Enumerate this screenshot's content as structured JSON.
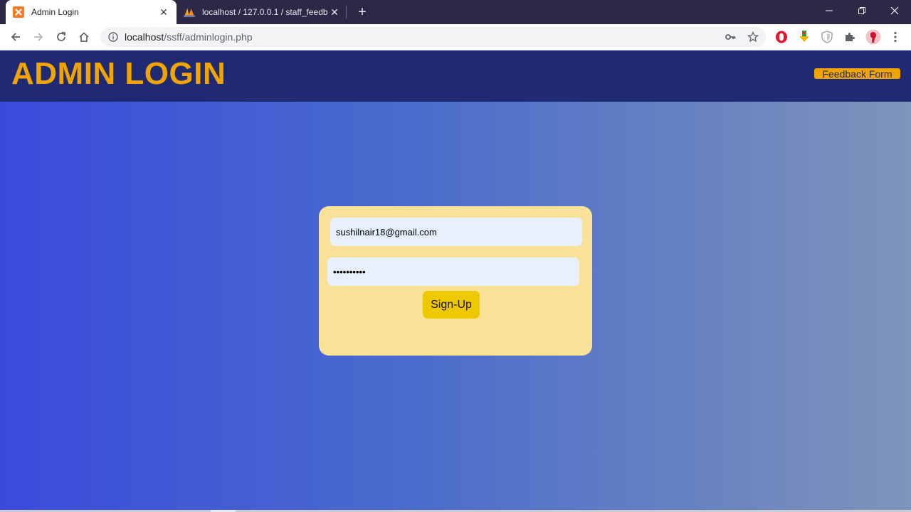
{
  "browser": {
    "tabs": [
      {
        "title": "Admin Login",
        "favicon": "xampp-icon",
        "active": true
      },
      {
        "title": "localhost / 127.0.0.1 / staff_feedb",
        "favicon": "phpmyadmin-icon",
        "active": false
      }
    ],
    "new_tab_label": "+",
    "address": {
      "host": "localhost",
      "path": "/ssff/adminlogin.php"
    },
    "toolbar_icons": [
      "back-icon",
      "forward-icon",
      "reload-icon",
      "home-icon",
      "info-icon",
      "key-icon",
      "star-icon",
      "opera-icon",
      "download-extension-icon",
      "shield-icon",
      "puzzle-icon",
      "profile-avatar-icon",
      "menu-icon"
    ],
    "window_controls": [
      "minimize-icon",
      "restore-icon",
      "close-icon"
    ]
  },
  "header": {
    "title": "ADMIN LOGIN",
    "feedback_button": "Feedback Form"
  },
  "login_form": {
    "email_value": "sushilnair18@gmail.com",
    "password_value": "••••••••••",
    "submit_label": "Sign-Up"
  },
  "colors": {
    "header_bg": "#1f2a72",
    "title_accent": "#f0a400",
    "card_bg": "#fae198",
    "field_bg": "#e8f0fe",
    "submit_bg": "#eec900",
    "page_gradient_start": "#3a4bdc",
    "page_gradient_end": "#7f94bb"
  }
}
